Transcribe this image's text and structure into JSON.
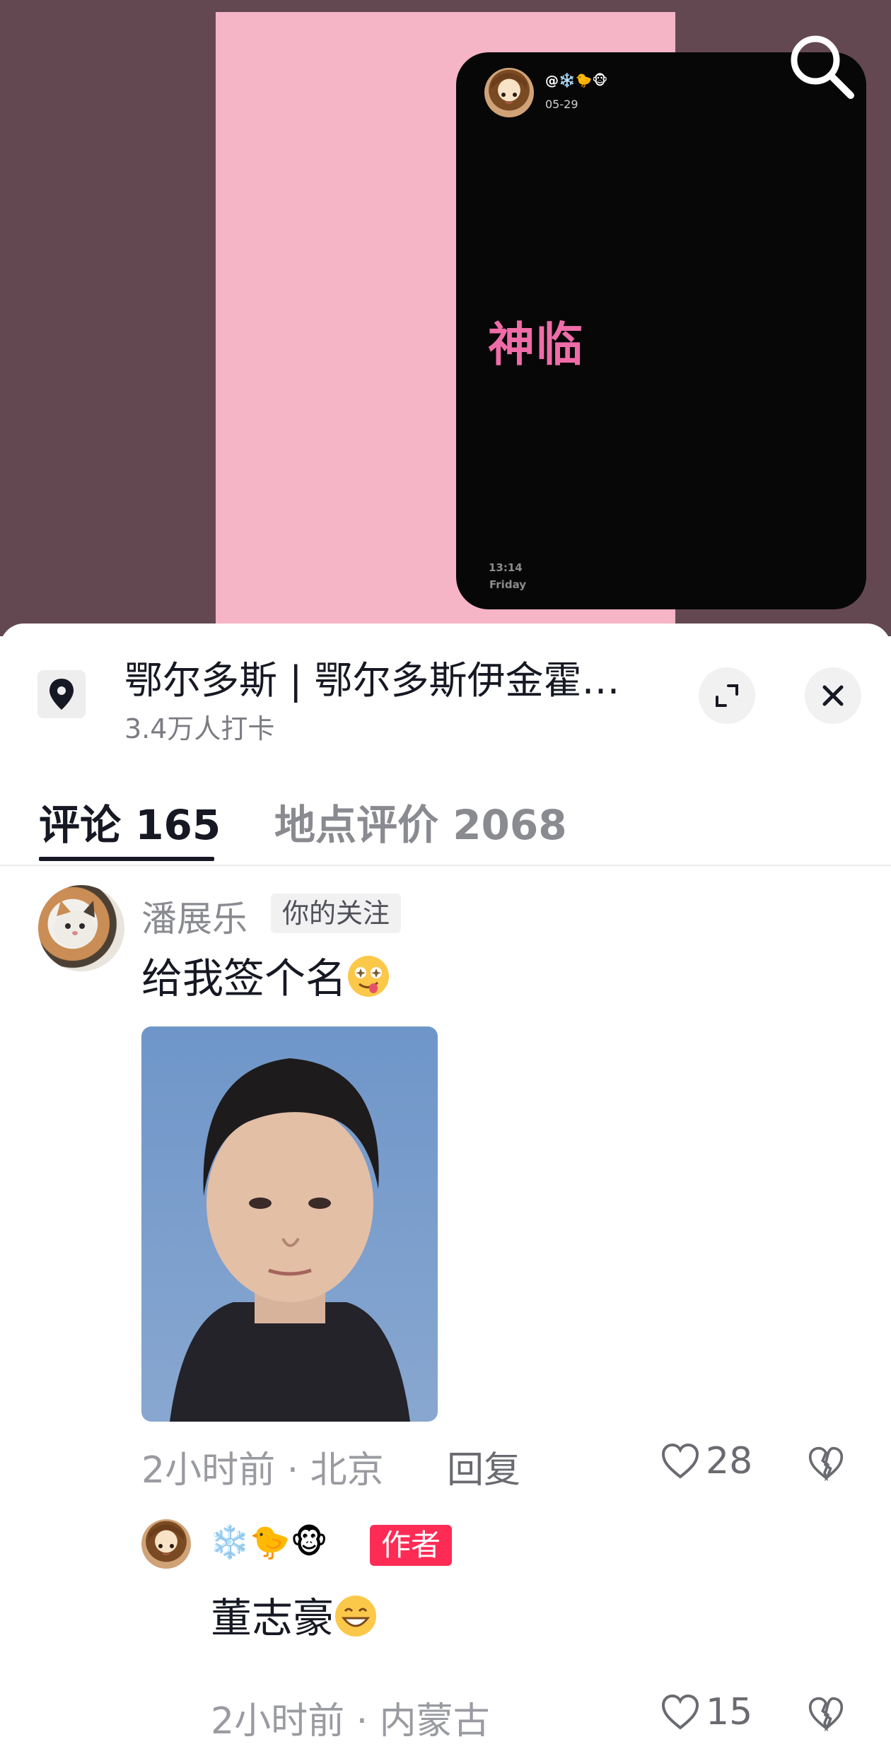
{
  "video": {
    "card_user": "@❄️🐤🐵",
    "card_date": "05-29",
    "headline": "神临",
    "time": "13:14",
    "day": "Friday"
  },
  "location": {
    "title": "鄂尔多斯 | 鄂尔多斯伊金霍…",
    "checkins": "3.4万人打卡"
  },
  "tabs": [
    {
      "label": "评论 165"
    },
    {
      "label": "地点评价 2068"
    }
  ],
  "comments": [
    {
      "username": "潘展乐",
      "badge": "你的关注",
      "text": "给我签个名",
      "meta": "2小时前 · 北京",
      "reply_label": "回复",
      "likes": "28"
    },
    {
      "username": "❄️🐤🐵",
      "badge": "作者",
      "text": "董志豪",
      "meta": "2小时前 · 内蒙古",
      "likes": "15"
    }
  ],
  "colors": {
    "video_bg": "#644851",
    "poster": "#f6b4c7",
    "headline": "#f06ca8",
    "author_badge": "#fe2c55"
  }
}
